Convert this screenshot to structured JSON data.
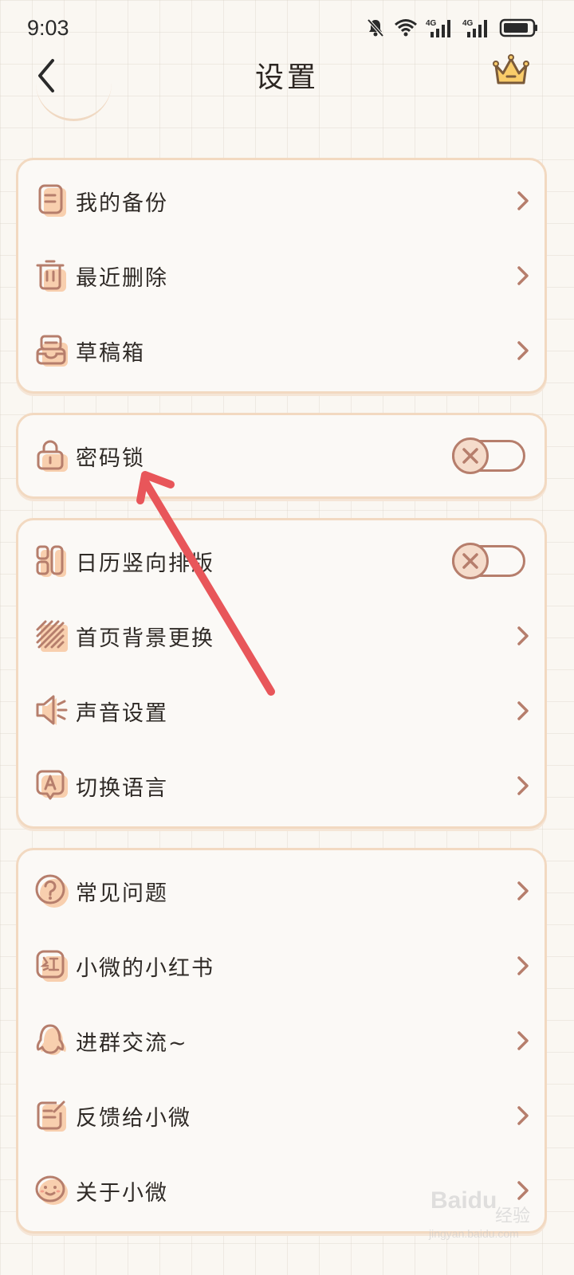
{
  "status_bar": {
    "time": "9:03",
    "network_label_1": "4G",
    "network_label_2": "4G"
  },
  "header": {
    "title": "设置"
  },
  "groups": {
    "data": [
      {
        "label": "我的备份"
      },
      {
        "label": "最近删除"
      },
      {
        "label": "草稿箱"
      }
    ],
    "lock": {
      "label": "密码锁",
      "enabled": false
    },
    "display": [
      {
        "label": "日历竖向排版",
        "enabled": false
      },
      {
        "label": "首页背景更换"
      },
      {
        "label": "声音设置"
      },
      {
        "label": "切换语言"
      }
    ],
    "support": [
      {
        "label": "常见问题"
      },
      {
        "label": "小微的小红书"
      },
      {
        "label": "进群交流~"
      },
      {
        "label": "反馈给小微"
      },
      {
        "label": "关于小微"
      }
    ]
  },
  "icons": {
    "backup": "note-icon",
    "deleted": "trash-icon",
    "drafts": "inbox-icon",
    "lock": "padlock-icon",
    "calendar": "vertical-layout-icon",
    "background": "stripes-icon",
    "sound": "speaker-icon",
    "language": "language-icon",
    "faq": "question-icon",
    "xiaohongshu": "red-badge-icon",
    "group": "penguin-icon",
    "feedback": "edit-note-icon",
    "about": "smile-face-icon",
    "vip": "crown-icon"
  },
  "colors": {
    "accent_border": "#f2d9c1",
    "icon_stroke": "#b67e6c",
    "icon_fill": "#f8cfae",
    "arrow": "#e8565a"
  },
  "watermark": {
    "brand": "Baidu",
    "brand_cn": "经验",
    "url": "jingyan.baidu.com"
  }
}
